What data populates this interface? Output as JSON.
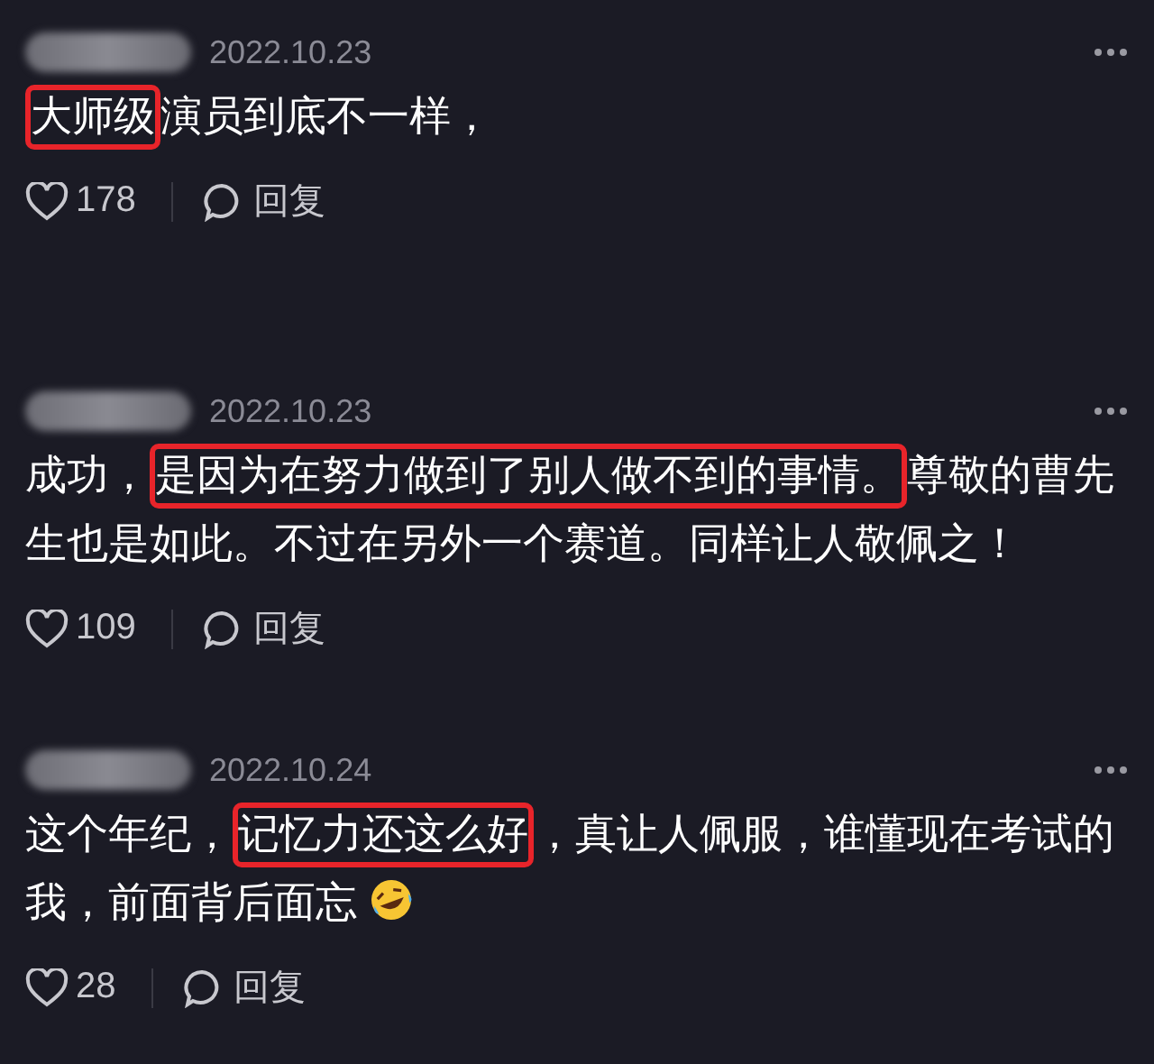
{
  "comments": [
    {
      "date": "2022.10.23",
      "segments": [
        {
          "text": "大师级",
          "highlighted": true
        },
        {
          "text": "演员到底不一样，",
          "highlighted": false
        }
      ],
      "likes": "178",
      "reply": "回复",
      "emoji": false
    },
    {
      "date": "2022.10.23",
      "segments": [
        {
          "text": "成功，",
          "highlighted": false
        },
        {
          "text": "是因为在努力做到了别人做不到的事情。",
          "highlighted": true
        },
        {
          "text": "尊敬的曹先生也是如此。不过在另外一个赛道。同样让人敬佩之！",
          "highlighted": false
        }
      ],
      "likes": "109",
      "reply": "回复",
      "emoji": false
    },
    {
      "date": "2022.10.24",
      "segments": [
        {
          "text": "这个年纪，",
          "highlighted": false
        },
        {
          "text": "记忆力还这么好",
          "highlighted": true
        },
        {
          "text": "，真让人佩服，谁懂现在考试的我，前面背后面忘",
          "highlighted": false
        }
      ],
      "likes": "28",
      "reply": "回复",
      "emoji": true
    }
  ]
}
